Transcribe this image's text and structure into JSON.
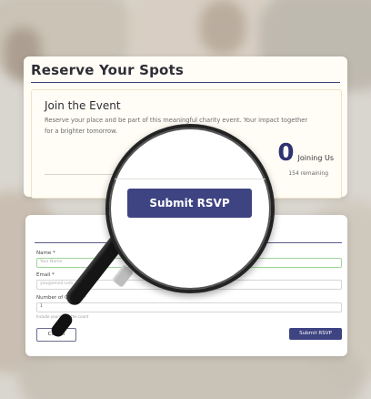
{
  "top_card": {
    "title": "Reserve Your Spots",
    "event_heading": "Join the Event",
    "event_text": "Reserve your place and be part of this meaningful charity event. Your impact together for a brighter tomorrow.",
    "count": "0",
    "count_label": "Joining Us",
    "remaining": "154 remaining"
  },
  "magnifier": {
    "button_label": "Submit RSVP"
  },
  "form": {
    "name_label": "Name *",
    "name_placeholder": "Your Name",
    "email_label": "Email *",
    "email_placeholder": "you@email.com",
    "guests_label": "Number of Guests *",
    "guests_value": "1",
    "guests_hint": "Include yourself in the count",
    "cancel_label": "Cancel",
    "submit_label": "Submit RSVP"
  },
  "colors": {
    "primary": "#3e4482",
    "card_bg": "#fffdf5",
    "focus_border": "#9fd49a"
  }
}
